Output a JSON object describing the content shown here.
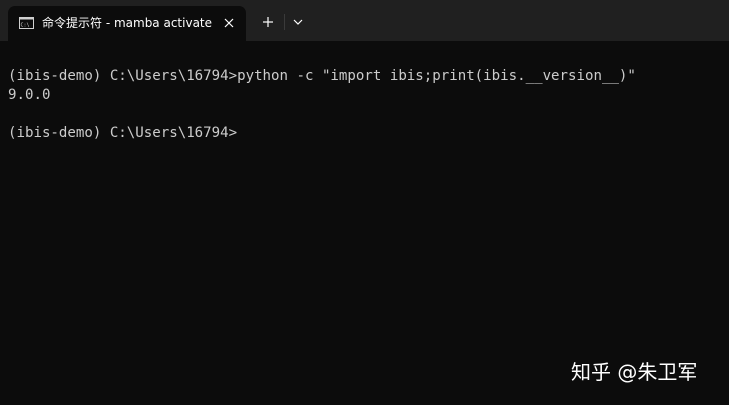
{
  "tab": {
    "icon": "cmd-icon",
    "icon_text": "C:\\",
    "title": "命令提示符 - mamba  activate"
  },
  "toolbar": {
    "new_tab": "plus-icon",
    "dropdown": "chevron-down-icon"
  },
  "terminal": {
    "lines": [
      "(ibis-demo) C:\\Users\\16794>python -c \"import ibis;print(ibis.__version__)\"",
      "9.0.0",
      "",
      "(ibis-demo) C:\\Users\\16794>"
    ]
  },
  "watermark": "知乎 @朱卫军",
  "colors": {
    "titlebar": "#202020",
    "terminal_bg": "#0c0c0c",
    "text": "#cccccc"
  }
}
